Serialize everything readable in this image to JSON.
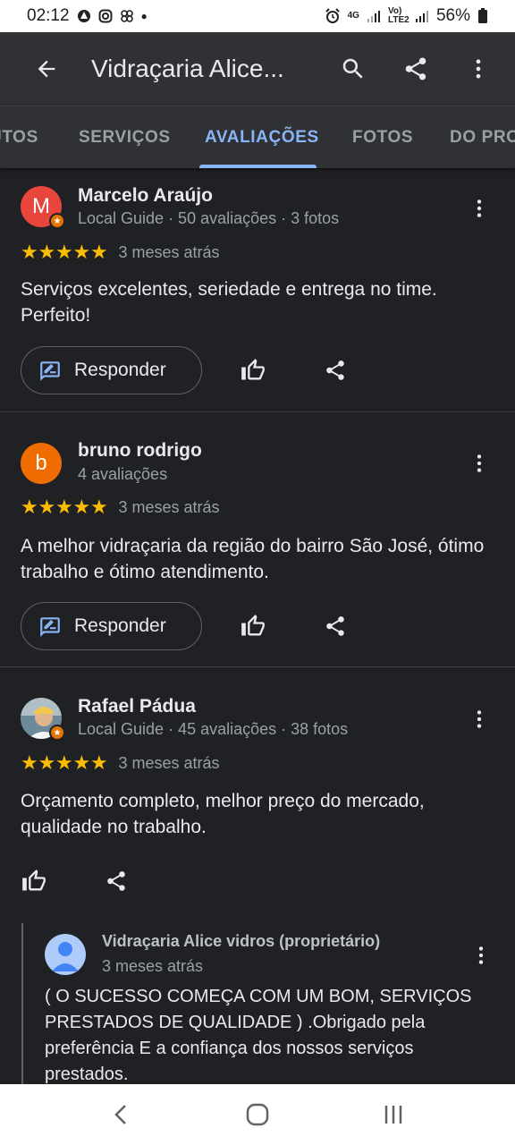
{
  "status_bar": {
    "time": "02:12",
    "network": "4G",
    "lte": "Vo) LTE2",
    "battery": "56%"
  },
  "app_bar": {
    "title": "Vidraçaria Alice..."
  },
  "tabs": [
    {
      "label": "UTOS"
    },
    {
      "label": "SERVIÇOS"
    },
    {
      "label": "AVALIAÇÕES"
    },
    {
      "label": "FOTOS"
    },
    {
      "label": "DO PRO"
    }
  ],
  "reviews": [
    {
      "avatar_letter": "M",
      "avatar_color": "#e8453c",
      "name": "Marcelo Araújo",
      "meta": "Local Guide · 50 avaliações · 3 fotos",
      "rating": 5,
      "date": "3 meses atrás",
      "text": "Serviços excelentes, seriedade e entrega no time. Perfeito!",
      "reply_label": "Responder"
    },
    {
      "avatar_letter": "b",
      "avatar_color": "#ef6c00",
      "name": "bruno rodrigo",
      "meta": "4 avaliações",
      "rating": 5,
      "date": "3 meses atrás",
      "text": "A melhor vidraçaria da região do bairro São José, ótimo trabalho e ótimo atendimento.",
      "reply_label": "Responder"
    },
    {
      "name": "Rafael Pádua",
      "meta": "Local Guide · 45 avaliações · 38 fotos",
      "rating": 5,
      "date": "3 meses atrás",
      "text": "Orçamento completo, melhor preço do mercado, qualidade no trabalho."
    }
  ],
  "owner_reply": {
    "name": "Vidraçaria Alice vidros (proprietário)",
    "date": "3 meses atrás",
    "text": "( O SUCESSO COMEÇA COM UM BOM, SERVIÇOS PRESTADOS DE QUALIDADE ) .Obrigado pela preferência E a confiança dos nossos serviços prestados."
  },
  "colors": {
    "accent": "#8ab4f8",
    "star": "#fbbc04",
    "background": "#202124",
    "appbar": "#303134"
  }
}
